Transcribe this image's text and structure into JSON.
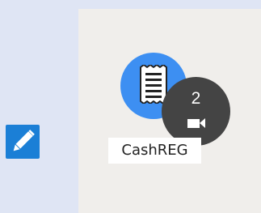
{
  "colors": {
    "left_panel_bg": "#dfe5f4",
    "canvas_bg": "#f0eeeb",
    "accent_blue": "#1b7fd6",
    "node_blue": "#3d8ff2",
    "badge_bg": "#444444",
    "label_bg": "#ffffff"
  },
  "toolbar": {
    "edit_icon": "pencil-icon"
  },
  "node": {
    "icon": "receipt-icon",
    "name": "CashREG",
    "badge": {
      "count": "2",
      "icon": "video-camera-icon"
    }
  }
}
